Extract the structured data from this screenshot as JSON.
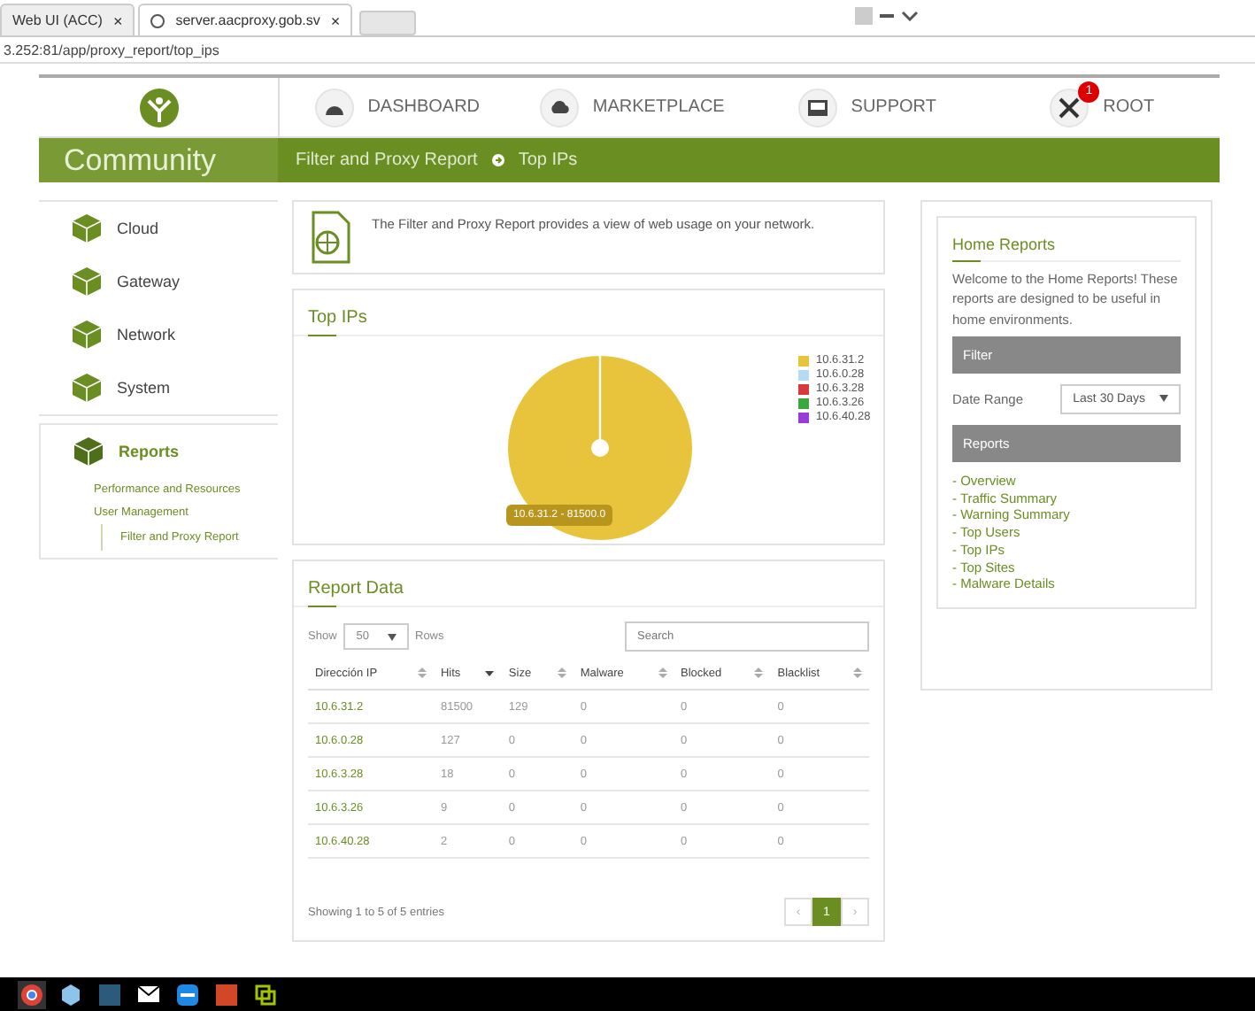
{
  "browser": {
    "tabs": [
      {
        "label": "Web UI (ACC)",
        "selected": false,
        "close": "×"
      },
      {
        "label": "server.aacproxy.gob.sv",
        "selected": true,
        "close": "×"
      }
    ],
    "address": "3.252:81/app/proxy_report/top_ips"
  },
  "nav": {
    "items": [
      {
        "label": "DASHBOARD",
        "kind": "dashboard"
      },
      {
        "label": "MARKETPLACE",
        "kind": "marketplace"
      },
      {
        "label": "SUPPORT",
        "kind": "support"
      },
      {
        "label": "ROOT",
        "kind": "root",
        "badge": "1"
      }
    ]
  },
  "banner": {
    "brand": "Community",
    "breadcrumbs": [
      "Filter and Proxy Report",
      "Top IPs"
    ]
  },
  "sidebar": {
    "items": [
      {
        "label": "Cloud",
        "selected": false
      },
      {
        "label": "Gateway",
        "selected": false
      },
      {
        "label": "Network",
        "selected": false
      },
      {
        "label": "System",
        "selected": false
      },
      {
        "label": "Reports",
        "selected": true,
        "children": [
          {
            "label": "Performance and Resources"
          },
          {
            "label": "User Management",
            "children": [
              {
                "label": "Filter and Proxy Report"
              }
            ]
          }
        ]
      }
    ]
  },
  "intro": "The Filter and Proxy Report provides a view of web usage on your network.",
  "top_ips": {
    "title": "Top IPs",
    "tooltip": "10.6.31.2 - 81500.0",
    "legend": [
      {
        "label": "10.6.31.2",
        "color": "#e8c43c"
      },
      {
        "label": "10.6.0.28",
        "color": "#b5dcf3"
      },
      {
        "label": "10.6.3.28",
        "color": "#d83a3a"
      },
      {
        "label": "10.6.3.26",
        "color": "#3aa83a"
      },
      {
        "label": "10.6.40.28",
        "color": "#9a3ad8"
      }
    ]
  },
  "report_data": {
    "title": "Report Data",
    "show_label": "Show",
    "rows_value": "50",
    "rows_label": "Rows",
    "search": {
      "placeholder": "Search"
    },
    "columns": [
      {
        "label": "Dirección IP",
        "sorted": false
      },
      {
        "label": "Hits",
        "sorted": true
      },
      {
        "label": "Size",
        "sorted": false
      },
      {
        "label": "Malware",
        "sorted": false
      },
      {
        "label": "Blocked",
        "sorted": false
      },
      {
        "label": "Blacklist",
        "sorted": false
      }
    ],
    "rows": [
      [
        "10.6.31.2",
        "81500",
        "129",
        "0",
        "0",
        "0"
      ],
      [
        "10.6.0.28",
        "127",
        "0",
        "0",
        "0",
        "0"
      ],
      [
        "10.6.3.28",
        "18",
        "0",
        "0",
        "0",
        "0"
      ],
      [
        "10.6.3.26",
        "9",
        "0",
        "0",
        "0",
        "0"
      ],
      [
        "10.6.40.28",
        "2",
        "0",
        "0",
        "0",
        "0"
      ]
    ],
    "summary": "Showing 1 to 5 of 5 entries",
    "pages": [
      {
        "label": "‹",
        "selected": false
      },
      {
        "label": "1",
        "selected": true
      },
      {
        "label": "›",
        "selected": false
      }
    ]
  },
  "home_reports": {
    "title": "Home Reports",
    "description": "Welcome to the Home Reports! These reports are designed to be useful in home environments.",
    "filter_heading": "Filter",
    "date_range_label": "Date Range",
    "date_range_value": "Last 30 Days",
    "reports_heading": "Reports",
    "links": [
      "- Overview",
      "- Traffic Summary",
      "- Warning Summary",
      "- Top Users",
      "- Top IPs",
      "- Top Sites",
      "- Malware Details"
    ]
  },
  "taskbar": {
    "apps": [
      {
        "kind": "browser",
        "selected": true
      },
      {
        "kind": "cube",
        "selected": false
      },
      {
        "kind": "database",
        "selected": false
      },
      {
        "kind": "mail",
        "selected": false
      },
      {
        "kind": "remote",
        "selected": false
      },
      {
        "kind": "slides",
        "selected": false
      },
      {
        "kind": "vm",
        "selected": false
      }
    ]
  }
}
